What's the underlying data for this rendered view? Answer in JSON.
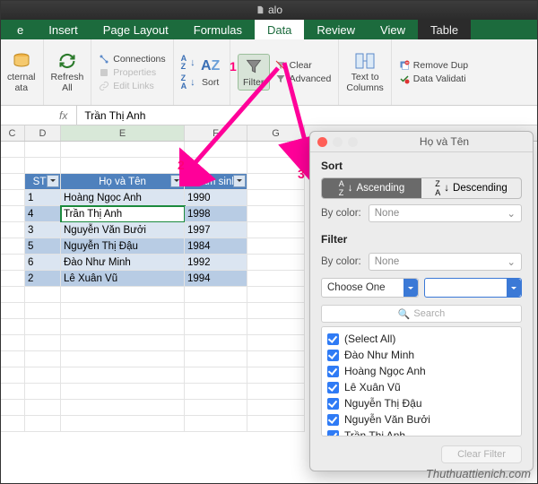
{
  "window": {
    "title": "alo"
  },
  "tabs": [
    "e",
    "Insert",
    "Page Layout",
    "Formulas",
    "Data",
    "Review",
    "View",
    "Table"
  ],
  "activeTab": "Data",
  "ribbon": {
    "external": "cternal\nata",
    "refresh": "Refresh\nAll",
    "conn": {
      "c1": "Connections",
      "c2": "Properties",
      "c3": "Edit Links"
    },
    "sort": "Sort",
    "filter": "Filter",
    "clear": "Clear",
    "advanced": "Advanced",
    "textcols": "Text to\nColumns",
    "removedup": "Remove Dup",
    "datavalid": "Data Validati"
  },
  "formula": {
    "fx": "fx",
    "value": "Trần Thị Anh"
  },
  "cols": [
    "C",
    "D",
    "E",
    "F",
    "G"
  ],
  "table": {
    "headers": [
      "STT",
      "Họ và Tên",
      "Năm sinh"
    ],
    "rows": [
      {
        "n": "1",
        "name": "Hoàng Ngọc Anh",
        "y": "1990"
      },
      {
        "n": "4",
        "name": "Trần Thị Anh",
        "y": "1998"
      },
      {
        "n": "3",
        "name": "Nguyễn Văn Bưởi",
        "y": "1997"
      },
      {
        "n": "5",
        "name": "Nguyễn Thị Đậu",
        "y": "1984"
      },
      {
        "n": "6",
        "name": "Đào Như Minh",
        "y": "1992"
      },
      {
        "n": "2",
        "name": "Lê Xuân Vũ",
        "y": "1994"
      }
    ]
  },
  "anno": {
    "n1": "1",
    "n2": "2",
    "n3": "3"
  },
  "popover": {
    "title": "Họ và Tên",
    "sort_h": "Sort",
    "asc": "Ascending",
    "desc": "Descending",
    "bycolor": "By color:",
    "none": "None",
    "filter_h": "Filter",
    "choose": "Choose One",
    "search": "Search",
    "items": [
      "(Select All)",
      "Đào Như Minh",
      "Hoàng Ngọc Anh",
      "Lê Xuân Vũ",
      "Nguyễn Thị Đậu",
      "Nguyễn Văn Bưởi",
      "Trần Thị Anh"
    ],
    "clear": "Clear Filter"
  },
  "watermark": "Thuthuattienich.com"
}
